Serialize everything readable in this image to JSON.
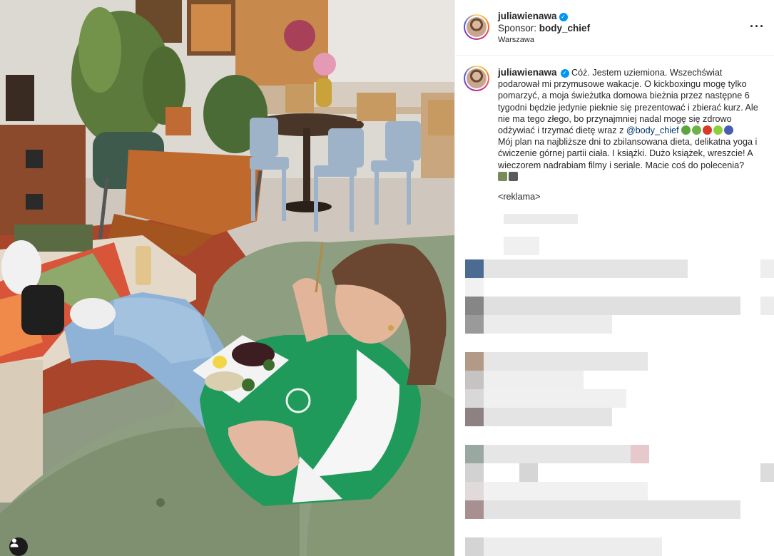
{
  "header": {
    "username": "juliawienawa",
    "sponsor_prefix": "Sponsor: ",
    "sponsor_name": "body_chief",
    "location": "Warszawa",
    "more_label": "···"
  },
  "caption": {
    "username": "juliawienawa",
    "text_part1": " Cóż. Jestem uziemiona. Wszechświat podarował mi przymusowe wakacje. O kickboxingu mogę tylko pomarzyć, a moja świeżutka domowa bieżnia przez następne 6 tygodni będzie jedynie pieknie się prezentować i zbierać kurz. Ale nie ma tego złego, bo przynajmniej nadal mogę się zdrowo odżywiać i trzymać dietę wraz z ",
    "mention": "@body_chief",
    "text_part2": "Mój plan na najbliższe dni to zbilansowana dieta, delikatna yoga i ćwiczenie górnej partii ciała. I książki. Dużo książek, wreszcie! A wieczorem nadrabiam filmy i seriale. Macie coś do polecenia?",
    "ad_label": "<reklama>"
  },
  "icons": {
    "verified": "verified-badge-icon",
    "more": "more-options-icon",
    "tagged_user": "user-tag-icon"
  },
  "colors": {
    "accent_link": "#00376b",
    "verified": "#0095f6",
    "text": "#262626"
  }
}
